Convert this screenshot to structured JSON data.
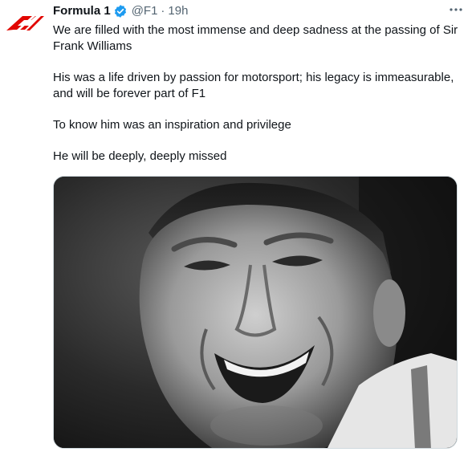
{
  "author": {
    "display_name": "Formula 1",
    "handle": "@F1",
    "separator": "·",
    "time": "19h",
    "avatar_icon": "f1-logo-icon",
    "verified_icon": "verified-badge-icon"
  },
  "tweet": {
    "paragraphs": [
      "We are filled with the most immense and deep sadness at the passing of Sir Frank Williams",
      "His was a life driven by passion for motorsport; his legacy is immeasurable, and will be forever part of F1",
      "To know him was an inspiration and privilege",
      "He will be deeply, deeply missed"
    ]
  },
  "media": {
    "type": "photo",
    "style": "black-and-white portrait"
  },
  "colors": {
    "brand_red": "#e10600",
    "verified_blue": "#1d9bf0",
    "secondary_text": "#536471",
    "primary_text": "#0f1419"
  },
  "icons": {
    "more": "more-options-icon"
  }
}
